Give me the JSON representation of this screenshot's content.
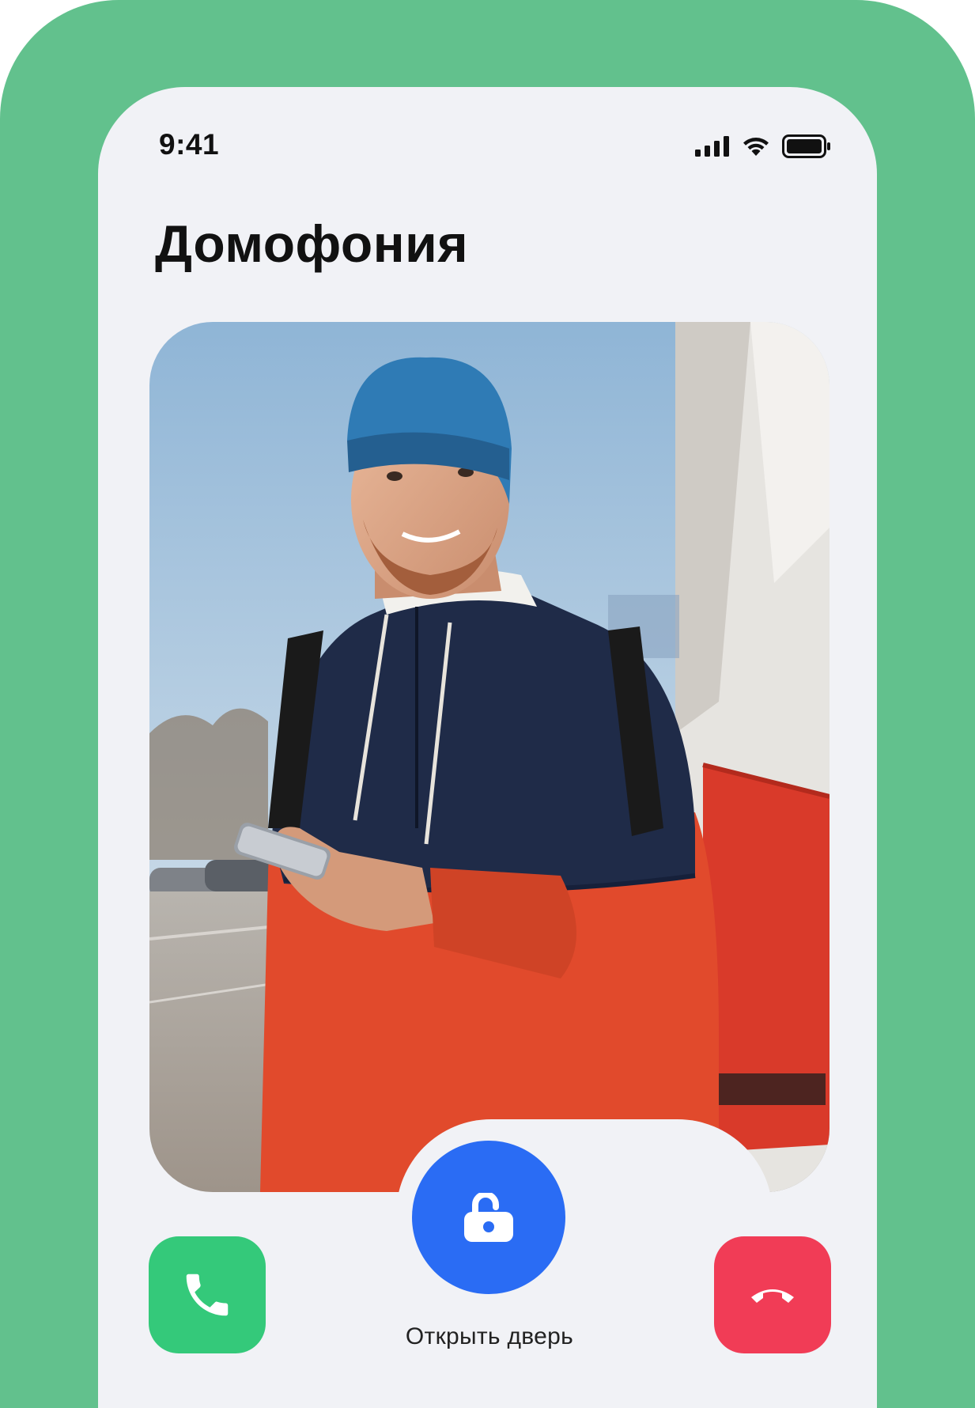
{
  "status_bar": {
    "time": "9:41",
    "icons": [
      "cellular-signal-icon",
      "wifi-icon",
      "battery-icon"
    ]
  },
  "header": {
    "title": "Домофония"
  },
  "video_feed": {
    "description_icon": "intercom-camera-feed"
  },
  "controls": {
    "unlock_label": "Открыть дверь",
    "unlock_icon": "unlock-icon",
    "accept_icon": "phone-icon",
    "decline_icon": "hang-up-icon"
  },
  "colors": {
    "frame": "#62c18d",
    "screen": "#f1f2f6",
    "unlock": "#2a6cf4",
    "accept": "#34c97a",
    "decline": "#f13c56"
  }
}
